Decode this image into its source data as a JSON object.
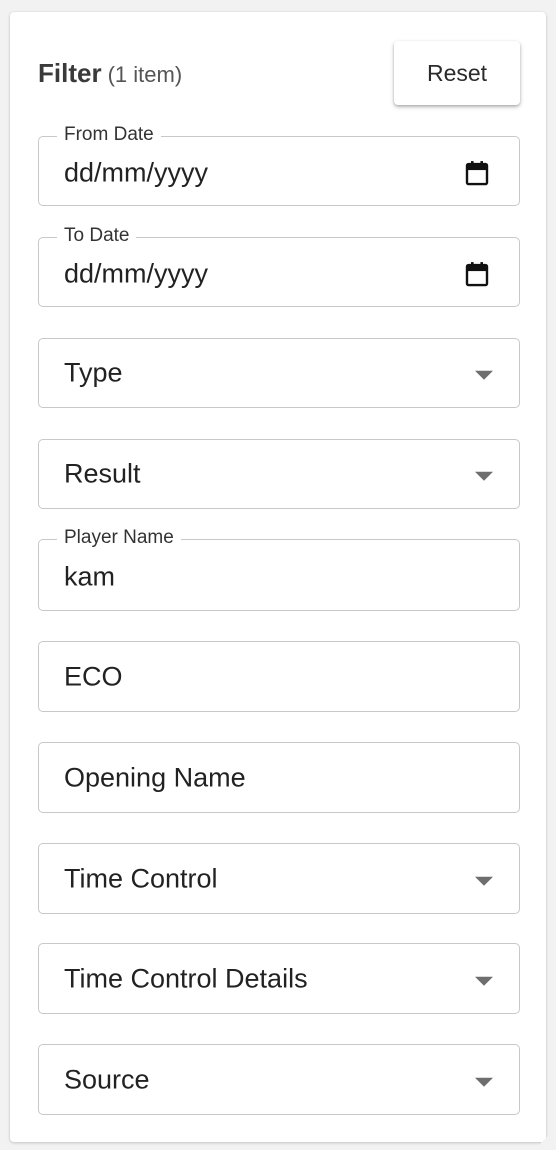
{
  "filter": {
    "title": "Filter",
    "count_label": "(1 item)",
    "reset_label": "Reset"
  },
  "fields": {
    "from_date": {
      "label": "From Date",
      "value": "dd/mm/yyyy",
      "icon": "calendar-icon"
    },
    "to_date": {
      "label": "To Date",
      "value": "dd/mm/yyyy",
      "icon": "calendar-icon"
    },
    "type": {
      "label": "Type",
      "icon": "caret-down-icon"
    },
    "result": {
      "label": "Result",
      "icon": "caret-down-icon"
    },
    "player_name": {
      "label": "Player Name",
      "value": "kam"
    },
    "eco": {
      "label": "ECO"
    },
    "opening_name": {
      "label": "Opening Name"
    },
    "time_control": {
      "label": "Time Control",
      "icon": "caret-down-icon"
    },
    "time_control_details": {
      "label": "Time Control Details",
      "icon": "caret-down-icon"
    },
    "source": {
      "label": "Source",
      "icon": "caret-down-icon"
    }
  }
}
